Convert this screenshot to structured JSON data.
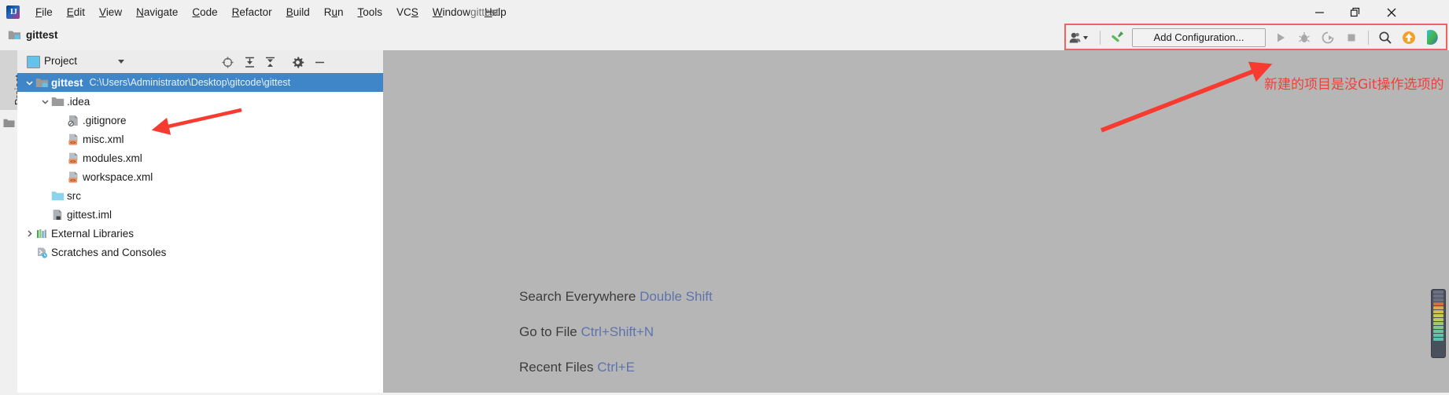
{
  "window": {
    "title": "gittest",
    "controls": [
      {
        "name": "minimize-button",
        "glyph": "minimize"
      },
      {
        "name": "restore-button",
        "glyph": "restore"
      },
      {
        "name": "close-button",
        "glyph": "close"
      }
    ]
  },
  "menubar": {
    "logo_text": "IJ",
    "items": [
      {
        "label": "File",
        "mnemonic": "F"
      },
      {
        "label": "Edit",
        "mnemonic": "E"
      },
      {
        "label": "View",
        "mnemonic": "V"
      },
      {
        "label": "Navigate",
        "mnemonic": "N"
      },
      {
        "label": "Code",
        "mnemonic": "C"
      },
      {
        "label": "Refactor",
        "mnemonic": "R"
      },
      {
        "label": "Build",
        "mnemonic": "B"
      },
      {
        "label": "Run",
        "mnemonic": "u"
      },
      {
        "label": "Tools",
        "mnemonic": "T"
      },
      {
        "label": "VCS",
        "mnemonic": "S"
      },
      {
        "label": "Window",
        "mnemonic": "W"
      },
      {
        "label": "Help",
        "mnemonic": "H"
      }
    ]
  },
  "toolbar": {
    "breadcrumb_project": "gittest",
    "run_configuration_label": "Add Configuration...",
    "buttons": [
      {
        "name": "user-account-dropdown",
        "icon": "user-icon"
      },
      {
        "name": "build-hammer-button",
        "icon": "hammer-icon"
      },
      {
        "name": "run-button",
        "icon": "run-play-icon"
      },
      {
        "name": "debug-button",
        "icon": "debug-bug-icon"
      },
      {
        "name": "run-with-coverage-button",
        "icon": "coverage-icon"
      },
      {
        "name": "stop-button",
        "icon": "stop-square-icon"
      },
      {
        "name": "search-everywhere-button",
        "icon": "search-icon"
      },
      {
        "name": "update-project-button",
        "icon": "update-arrow-icon"
      },
      {
        "name": "ide-assistant-button",
        "icon": "play-colored-icon"
      }
    ]
  },
  "tool_strip": {
    "tab_label": "Project",
    "folder_icon": "folder-icon"
  },
  "project_panel": {
    "title": "Project",
    "header_buttons": [
      {
        "name": "scroll-from-source-button",
        "icon": "target-icon"
      },
      {
        "name": "expand-all-button",
        "icon": "expand-all-icon"
      },
      {
        "name": "collapse-all-button",
        "icon": "collapse-all-icon"
      },
      {
        "name": "panel-settings-button",
        "icon": "gear-icon"
      },
      {
        "name": "hide-panel-button",
        "icon": "minus-icon"
      }
    ],
    "tree": [
      {
        "label": "gittest",
        "path": "C:\\Users\\Administrator\\Desktop\\gitcode\\gittest",
        "icon": "module-folder-icon",
        "indent": 0,
        "twisty": "down",
        "selected": true,
        "bold": true
      },
      {
        "label": ".idea",
        "path": "",
        "icon": "folder-icon",
        "indent": 1,
        "twisty": "down",
        "selected": false,
        "bold": false
      },
      {
        "label": ".gitignore",
        "path": "",
        "icon": "ignored-file-icon",
        "indent": 2,
        "twisty": "none",
        "selected": false,
        "bold": false
      },
      {
        "label": "misc.xml",
        "path": "",
        "icon": "xml-file-icon",
        "indent": 2,
        "twisty": "none",
        "selected": false,
        "bold": false
      },
      {
        "label": "modules.xml",
        "path": "",
        "icon": "xml-file-icon",
        "indent": 2,
        "twisty": "none",
        "selected": false,
        "bold": false
      },
      {
        "label": "workspace.xml",
        "path": "",
        "icon": "xml-file-icon",
        "indent": 2,
        "twisty": "none",
        "selected": false,
        "bold": false
      },
      {
        "label": "src",
        "path": "",
        "icon": "source-folder-icon",
        "indent": 1,
        "twisty": "none",
        "selected": false,
        "bold": false
      },
      {
        "label": "gittest.iml",
        "path": "",
        "icon": "iml-file-icon",
        "indent": 1,
        "twisty": "none",
        "selected": false,
        "bold": false
      },
      {
        "label": "External Libraries",
        "path": "",
        "icon": "libraries-icon",
        "indent": 0,
        "twisty": "right",
        "selected": false,
        "bold": false
      },
      {
        "label": "Scratches and Consoles",
        "path": "",
        "icon": "scratches-icon",
        "indent": 0,
        "twisty": "none",
        "selected": false,
        "bold": false
      }
    ]
  },
  "editor": {
    "hints": [
      {
        "action": "Search Everywhere",
        "shortcut": "Double Shift"
      },
      {
        "action": "Go to File",
        "shortcut": "Ctrl+Shift+N"
      },
      {
        "action": "Recent Files",
        "shortcut": "Ctrl+E"
      }
    ],
    "error_stripe_colors": [
      "#6b7180",
      "#6b7180",
      "#6b7180",
      "#d96b4a",
      "#d9a94a",
      "#cfc24a",
      "#c6cc52",
      "#b9cc5a",
      "#9fc96a",
      "#86c882",
      "#6cc69a",
      "#5fc4a8",
      "#59c2b2"
    ]
  },
  "annotations": {
    "note_text": "新建的项目是没Git操作选项的",
    "note_color": "#f0403a",
    "highlight_color": "#f2635f"
  }
}
